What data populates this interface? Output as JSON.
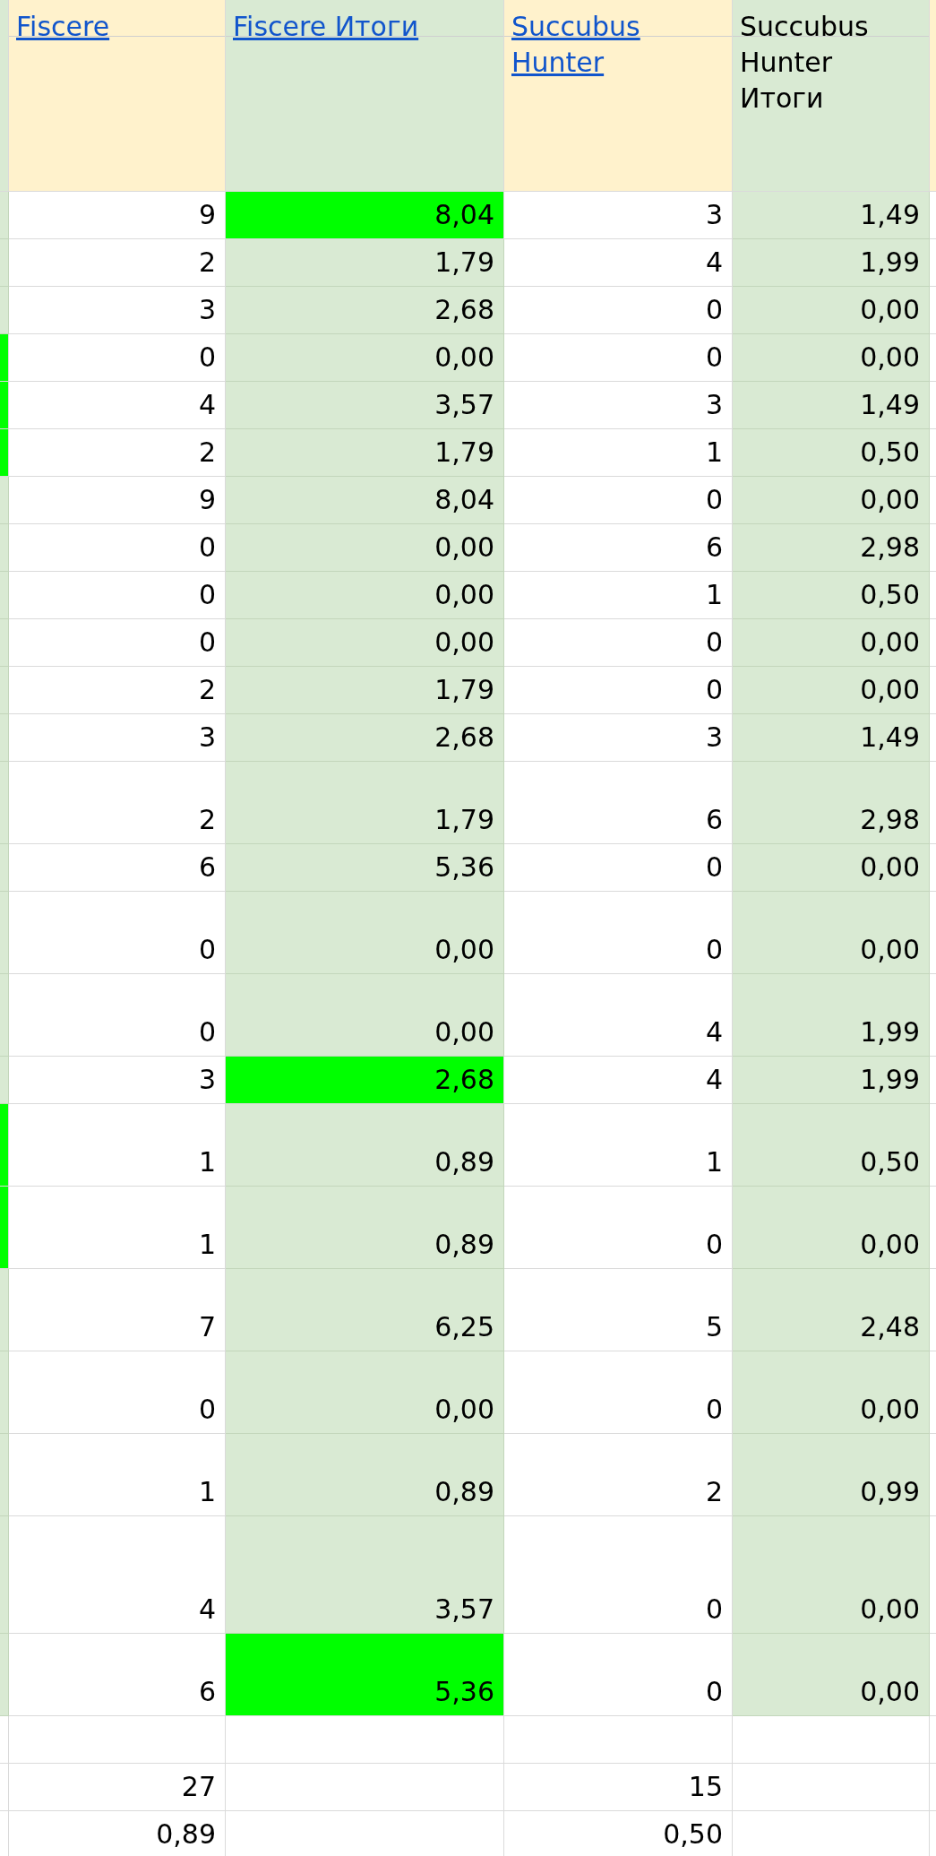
{
  "columns": [
    {
      "title": "Fiscere",
      "link": true,
      "shaded": false
    },
    {
      "title": "Fiscere Итоги",
      "link": true,
      "shaded": true
    },
    {
      "title": "Succubus Hunter",
      "link": true,
      "shaded": false
    },
    {
      "title": "Succubus Hunter Итоги",
      "link": false,
      "shaded": true
    }
  ],
  "rows": [
    {
      "kind": "data",
      "edge_highlight": false,
      "cells": [
        {
          "text": "9",
          "highlight": false
        },
        {
          "text": "8,04",
          "highlight": true
        },
        {
          "text": "3",
          "highlight": false
        },
        {
          "text": "1,49",
          "highlight": false
        }
      ]
    },
    {
      "kind": "data",
      "edge_highlight": false,
      "cells": [
        {
          "text": "2",
          "highlight": false
        },
        {
          "text": "1,79",
          "highlight": false
        },
        {
          "text": "4",
          "highlight": false
        },
        {
          "text": "1,99",
          "highlight": false
        }
      ]
    },
    {
      "kind": "data",
      "edge_highlight": false,
      "cells": [
        {
          "text": "3",
          "highlight": false
        },
        {
          "text": "2,68",
          "highlight": false
        },
        {
          "text": "0",
          "highlight": false
        },
        {
          "text": "0,00",
          "highlight": false
        }
      ]
    },
    {
      "kind": "data",
      "edge_highlight": true,
      "cells": [
        {
          "text": "0",
          "highlight": false
        },
        {
          "text": "0,00",
          "highlight": false
        },
        {
          "text": "0",
          "highlight": false
        },
        {
          "text": "0,00",
          "highlight": false
        }
      ]
    },
    {
      "kind": "data",
      "edge_highlight": true,
      "cells": [
        {
          "text": "4",
          "highlight": false
        },
        {
          "text": "3,57",
          "highlight": false
        },
        {
          "text": "3",
          "highlight": false
        },
        {
          "text": "1,49",
          "highlight": false
        }
      ]
    },
    {
      "kind": "data",
      "edge_highlight": true,
      "cells": [
        {
          "text": "2",
          "highlight": false
        },
        {
          "text": "1,79",
          "highlight": false
        },
        {
          "text": "1",
          "highlight": false
        },
        {
          "text": "0,50",
          "highlight": false
        }
      ]
    },
    {
      "kind": "data",
      "edge_highlight": false,
      "cells": [
        {
          "text": "9",
          "highlight": false
        },
        {
          "text": "8,04",
          "highlight": false
        },
        {
          "text": "0",
          "highlight": false
        },
        {
          "text": "0,00",
          "highlight": false
        }
      ]
    },
    {
      "kind": "data",
      "edge_highlight": false,
      "cells": [
        {
          "text": "0",
          "highlight": false
        },
        {
          "text": "0,00",
          "highlight": false
        },
        {
          "text": "6",
          "highlight": false
        },
        {
          "text": "2,98",
          "highlight": false
        }
      ]
    },
    {
      "kind": "data",
      "edge_highlight": false,
      "cells": [
        {
          "text": "0",
          "highlight": false
        },
        {
          "text": "0,00",
          "highlight": false
        },
        {
          "text": "1",
          "highlight": false
        },
        {
          "text": "0,50",
          "highlight": false
        }
      ]
    },
    {
      "kind": "data",
      "edge_highlight": false,
      "cells": [
        {
          "text": "0",
          "highlight": false
        },
        {
          "text": "0,00",
          "highlight": false
        },
        {
          "text": "0",
          "highlight": false
        },
        {
          "text": "0,00",
          "highlight": false
        }
      ]
    },
    {
      "kind": "data",
      "edge_highlight": false,
      "cells": [
        {
          "text": "2",
          "highlight": false
        },
        {
          "text": "1,79",
          "highlight": false
        },
        {
          "text": "0",
          "highlight": false
        },
        {
          "text": "0,00",
          "highlight": false
        }
      ]
    },
    {
      "kind": "data",
      "edge_highlight": false,
      "cells": [
        {
          "text": "3",
          "highlight": false
        },
        {
          "text": "2,68",
          "highlight": false
        },
        {
          "text": "3",
          "highlight": false
        },
        {
          "text": "1,49",
          "highlight": false
        }
      ]
    },
    {
      "kind": "data",
      "edge_highlight": false,
      "cells": [
        {
          "text": "2",
          "highlight": false
        },
        {
          "text": "1,79",
          "highlight": false
        },
        {
          "text": "6",
          "highlight": false
        },
        {
          "text": "2,98",
          "highlight": false
        }
      ]
    },
    {
      "kind": "data",
      "edge_highlight": false,
      "cells": [
        {
          "text": "6",
          "highlight": false
        },
        {
          "text": "5,36",
          "highlight": false
        },
        {
          "text": "0",
          "highlight": false
        },
        {
          "text": "0,00",
          "highlight": false
        }
      ]
    },
    {
      "kind": "data",
      "edge_highlight": false,
      "cells": [
        {
          "text": "0",
          "highlight": false
        },
        {
          "text": "0,00",
          "highlight": false
        },
        {
          "text": "0",
          "highlight": false
        },
        {
          "text": "0,00",
          "highlight": false
        }
      ]
    },
    {
      "kind": "data",
      "edge_highlight": false,
      "cells": [
        {
          "text": "0",
          "highlight": false
        },
        {
          "text": "0,00",
          "highlight": false
        },
        {
          "text": "4",
          "highlight": false
        },
        {
          "text": "1,99",
          "highlight": false
        }
      ]
    },
    {
      "kind": "data",
      "edge_highlight": false,
      "cells": [
        {
          "text": "3",
          "highlight": false
        },
        {
          "text": "2,68",
          "highlight": true
        },
        {
          "text": "4",
          "highlight": false
        },
        {
          "text": "1,99",
          "highlight": false
        }
      ]
    },
    {
      "kind": "data",
      "edge_highlight": true,
      "cells": [
        {
          "text": "1",
          "highlight": false
        },
        {
          "text": "0,89",
          "highlight": false
        },
        {
          "text": "1",
          "highlight": false
        },
        {
          "text": "0,50",
          "highlight": false
        }
      ]
    },
    {
      "kind": "data",
      "edge_highlight": true,
      "cells": [
        {
          "text": "1",
          "highlight": false
        },
        {
          "text": "0,89",
          "highlight": false
        },
        {
          "text": "0",
          "highlight": false
        },
        {
          "text": "0,00",
          "highlight": false
        }
      ]
    },
    {
      "kind": "data",
      "edge_highlight": false,
      "cells": [
        {
          "text": "7",
          "highlight": false
        },
        {
          "text": "6,25",
          "highlight": false
        },
        {
          "text": "5",
          "highlight": false
        },
        {
          "text": "2,48",
          "highlight": false
        }
      ]
    },
    {
      "kind": "data",
      "edge_highlight": false,
      "cells": [
        {
          "text": "0",
          "highlight": false
        },
        {
          "text": "0,00",
          "highlight": false
        },
        {
          "text": "0",
          "highlight": false
        },
        {
          "text": "0,00",
          "highlight": false
        }
      ]
    },
    {
      "kind": "data",
      "edge_highlight": false,
      "cells": [
        {
          "text": "1",
          "highlight": false
        },
        {
          "text": "0,89",
          "highlight": false
        },
        {
          "text": "2",
          "highlight": false
        },
        {
          "text": "0,99",
          "highlight": false
        }
      ]
    },
    {
      "kind": "data",
      "edge_highlight": false,
      "cells": [
        {
          "text": "4",
          "highlight": false
        },
        {
          "text": "3,57",
          "highlight": false
        },
        {
          "text": "0",
          "highlight": false
        },
        {
          "text": "0,00",
          "highlight": false
        }
      ]
    },
    {
      "kind": "data",
      "edge_highlight": false,
      "cells": [
        {
          "text": "6",
          "highlight": false
        },
        {
          "text": "5,36",
          "highlight": true
        },
        {
          "text": "0",
          "highlight": false
        },
        {
          "text": "0,00",
          "highlight": false
        }
      ]
    },
    {
      "kind": "blank"
    },
    {
      "kind": "summary",
      "values": [
        "27",
        "15"
      ]
    },
    {
      "kind": "summary",
      "values": [
        "0,89",
        "0,50"
      ]
    }
  ]
}
